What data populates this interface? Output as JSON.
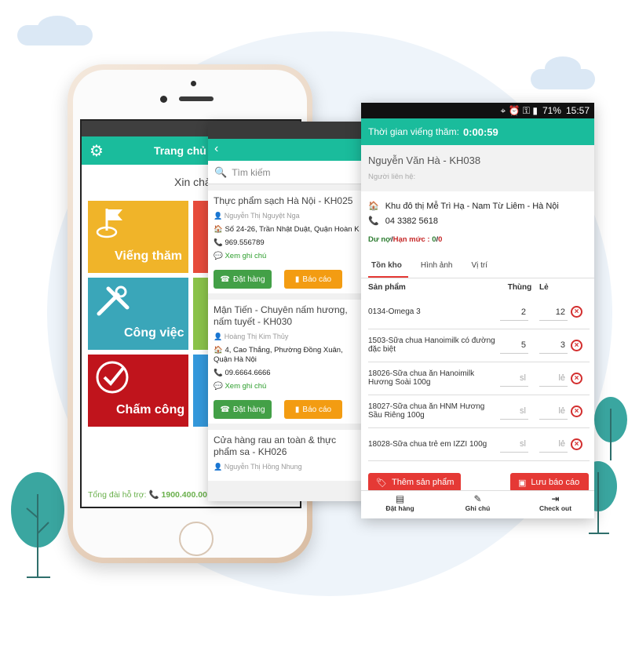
{
  "phone_main": {
    "header_title": "Trang chủ",
    "greeting": "Xin chà",
    "tiles": [
      {
        "label": "Viếng thăm",
        "color": "#f0b429",
        "icon": "flag-icon"
      },
      {
        "label": "Công việc",
        "color": "#3aa6b9",
        "icon": "tools-icon"
      },
      {
        "label": "Chấm công",
        "color": "#c0141c",
        "icon": "check-circle-icon"
      }
    ],
    "hotline_label": "Tổng đài hỗ trợ:",
    "hotline_number": "1900.400.00"
  },
  "customer_list": {
    "search_placeholder": "Tìm kiếm",
    "customers": [
      {
        "name": "Thực phẩm sạch Hà Nội - KH025",
        "contact": "Nguyễn Thị Nguyệt Nga",
        "address": "Số 24-26, Trần Nhật Duật, Quận Hoàn Ki",
        "phone": "969.556789",
        "note": "Xem ghi chú"
      },
      {
        "name": "Mận Tiến - Chuyên nấm hương, nấm tuyết - KH030",
        "contact": "Hoàng Thị Kim Thủy",
        "address": "4, Cao Thắng, Phường Đồng Xuân, Quận Hà Nội",
        "phone": "09.6664.6666",
        "note": "Xem ghi chú"
      },
      {
        "name": "Cửa hàng rau an toàn & thực phẩm sa - KH026",
        "contact": "Nguyễn Thị Hồng Nhung"
      }
    ],
    "order_button": "Đặt hàng",
    "report_button": "Báo cáo"
  },
  "visit": {
    "status_time": "15:57",
    "battery": "71%",
    "timer_label": "Thời gian viếng thăm:",
    "timer_value": "0:00:59",
    "customer_name": "Nguyễn Văn Hà - KH038",
    "contact_label": "Người liên hệ:",
    "address": "Khu đô thị Mễ Trì Hạ - Nam Từ Liêm - Hà Nội",
    "phone": "04 3382 5618",
    "debt_label": "Dư nợ",
    "limit_label": "Hạn mức :",
    "debt_value": "0",
    "limit_value": "0",
    "tabs": [
      "Tồn kho",
      "Hình ảnh",
      "Vị trí"
    ],
    "columns": [
      "Sản phẩm",
      "Thùng",
      "Lẻ"
    ],
    "placeholders": {
      "box": "sl",
      "unit": "lẻ"
    },
    "products": [
      {
        "name": "0134-Omega 3",
        "box": "2",
        "unit": "12"
      },
      {
        "name": "1503-Sữa chua Hanoimilk có đường đặc biệt",
        "box": "5",
        "unit": "3"
      },
      {
        "name": "18026-Sữa chua ăn Hanoimilk Hương Soài 100g",
        "box": "",
        "unit": ""
      },
      {
        "name": "18027-Sữa chua ăn HNM Hương Sầu Riêng 100g",
        "box": "",
        "unit": ""
      },
      {
        "name": "18028-Sữa chua trẻ em IZZI 100g",
        "box": "",
        "unit": ""
      }
    ],
    "add_button": "Thêm sản phẩm",
    "save_button": "Lưu báo cáo",
    "footer": [
      {
        "label": "Đặt hàng",
        "icon": "order-list-icon"
      },
      {
        "label": "Ghi chú",
        "icon": "pencil-icon"
      },
      {
        "label": "Check out",
        "icon": "exit-icon"
      }
    ],
    "colors": {
      "accent": "#1abc9c",
      "danger": "#e53935",
      "order": "#43a047",
      "report": "#f39c12"
    }
  }
}
